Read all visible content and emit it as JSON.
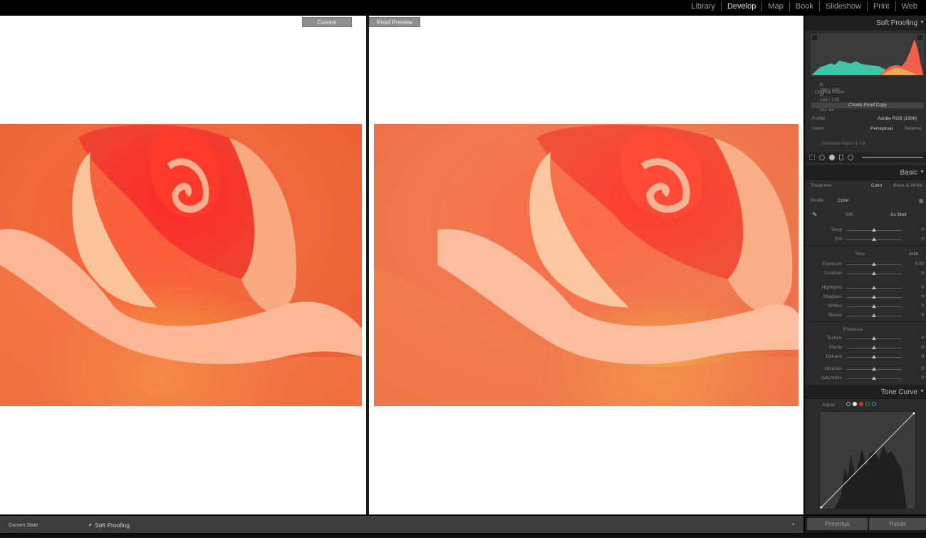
{
  "modules": [
    {
      "label": "Library",
      "active": false
    },
    {
      "label": "Develop",
      "active": true
    },
    {
      "label": "Map",
      "active": false
    },
    {
      "label": "Book",
      "active": false
    },
    {
      "label": "Slideshow",
      "active": false
    },
    {
      "label": "Print",
      "active": false
    },
    {
      "label": "Web",
      "active": false
    }
  ],
  "compare": {
    "left_label": "Current",
    "right_label": "Proof Preview"
  },
  "soft_proofing_panel": {
    "title": "Soft Proofing",
    "readout": {
      "r_label": "R",
      "r_val": "269 / 229",
      "g_label": "G",
      "g_val": "155 / 139",
      "b_label": "B",
      "b_val": "96 / 84"
    },
    "original_photo": "Original Photo",
    "create_proof_copy": "Create Proof Copy",
    "profile_label": "Profile",
    "profile_value": "Adobe RGB (1998)",
    "intent_label": "Intent",
    "intent_options": [
      "Perceptual",
      "Relative"
    ],
    "simulate": "Simulate Paper & Ink"
  },
  "basic_panel": {
    "title": "Basic",
    "treatment_label": "Treatment",
    "treatment_options": [
      "Color",
      "Black & White"
    ],
    "profile_label": "Profile",
    "profile_value": "Color",
    "wb_label": "WB",
    "wb_value": "As Shot",
    "tone_label": "Tone",
    "auto_label": "Auto",
    "presence_label": "Presence",
    "sliders_wb": [
      {
        "label": "Temp",
        "value": "0",
        "pos": 0.5
      },
      {
        "label": "Tint",
        "value": "0",
        "pos": 0.5
      }
    ],
    "sliders_tone": [
      {
        "label": "Exposure",
        "value": "0.00",
        "pos": 0.5
      },
      {
        "label": "Contrast",
        "value": "0",
        "pos": 0.5
      }
    ],
    "sliders_tone2": [
      {
        "label": "Highlights",
        "value": "0",
        "pos": 0.5
      },
      {
        "label": "Shadows",
        "value": "0",
        "pos": 0.5
      },
      {
        "label": "Whites",
        "value": "0",
        "pos": 0.5
      },
      {
        "label": "Blacks",
        "value": "0",
        "pos": 0.5
      }
    ],
    "sliders_presence": [
      {
        "label": "Texture",
        "value": "0",
        "pos": 0.5
      },
      {
        "label": "Clarity",
        "value": "0",
        "pos": 0.5
      },
      {
        "label": "Dehaze",
        "value": "0",
        "pos": 0.5
      }
    ],
    "sliders_presence2": [
      {
        "label": "Vibrance",
        "value": "0",
        "pos": 0.5
      },
      {
        "label": "Saturation",
        "value": "0",
        "pos": 0.5
      }
    ]
  },
  "tone_curve_panel": {
    "title": "Tone Curve",
    "adjust_label": "Adjust"
  },
  "toolbar": {
    "state_label": "Current State",
    "soft_proofing_checkbox": "Soft Proofing"
  },
  "panel_buttons": {
    "previous": "Previous",
    "reset": "Reset"
  },
  "colors": {
    "accent_teal": "#3fc6a6",
    "histogram_red": "#f0604a",
    "panel_bg": "#2b2b2b"
  }
}
